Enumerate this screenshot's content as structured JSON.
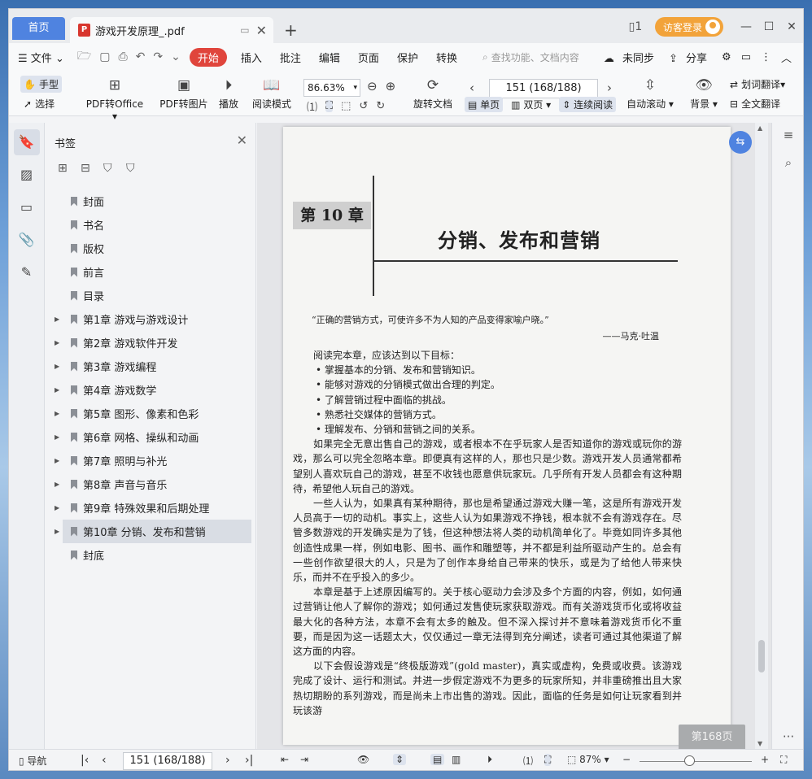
{
  "tabs": {
    "home": "首页",
    "doc_title": "游戏开发原理_.pdf",
    "add": "+"
  },
  "titlebar": {
    "login": "访客登录"
  },
  "menu": {
    "file": "文件",
    "start": "开始",
    "items": [
      "插入",
      "批注",
      "编辑",
      "页面",
      "保护",
      "转换"
    ],
    "search_placeholder": "查找功能、文档内容",
    "sync": "未同步",
    "share": "分享"
  },
  "ribbon": {
    "hand": "手型",
    "select": "选择",
    "pdf_to_office": "PDF转Office",
    "pdf_to_image": "PDF转图片",
    "play": "播放",
    "read_mode": "阅读模式",
    "zoom": "86.63%",
    "rotate": "旋转文档",
    "page_input": "151 (168/188)",
    "single": "单页",
    "double": "双页",
    "continuous": "连续阅读",
    "auto_scroll": "自动滚动",
    "background": "背景",
    "translate_word": "划词翻译",
    "translate_full": "全文翻译"
  },
  "bookmarks": {
    "title": "书签",
    "items": [
      {
        "label": "封面",
        "expandable": false
      },
      {
        "label": "书名",
        "expandable": false
      },
      {
        "label": "版权",
        "expandable": false
      },
      {
        "label": "前言",
        "expandable": false
      },
      {
        "label": "目录",
        "expandable": false
      },
      {
        "label": "第1章   游戏与游戏设计",
        "expandable": true
      },
      {
        "label": "第2章   游戏软件开发",
        "expandable": true
      },
      {
        "label": "第3章   游戏编程",
        "expandable": true
      },
      {
        "label": "第4章   游戏数学",
        "expandable": true
      },
      {
        "label": "第5章   图形、像素和色彩",
        "expandable": true
      },
      {
        "label": "第6章   网格、操纵和动画",
        "expandable": true
      },
      {
        "label": "第7章   照明与补光",
        "expandable": true
      },
      {
        "label": "第8章   声音与音乐",
        "expandable": true
      },
      {
        "label": "第9章   特殊效果和后期处理",
        "expandable": true
      },
      {
        "label": "第10章   分销、发布和营销",
        "expandable": true,
        "selected": true
      },
      {
        "label": "封底",
        "expandable": false
      }
    ]
  },
  "page": {
    "chapter_num": "第 10 章",
    "chapter_title": "分销、发布和营销",
    "quote": "“正确的营销方式，可使许多不为人知的产品变得家喻户晓。”",
    "quote_author": "——马克·吐温",
    "intro": "阅读完本章，应该达到以下目标：",
    "bullets": [
      "掌握基本的分销、发布和营销知识。",
      "能够对游戏的分销模式做出合理的判定。",
      "了解营销过程中面临的挑战。",
      "熟悉社交媒体的营销方式。",
      "理解发布、分销和营销之间的关系。"
    ],
    "paragraphs": [
      "如果完全无意出售自己的游戏，或者根本不在乎玩家人是否知道你的游戏或玩你的游戏，那么可以完全忽略本章。即便真有这样的人，那也只是少数。游戏开发人员通常都希望别人喜欢玩自己的游戏，甚至不收钱也愿意供玩家玩。几乎所有开发人员都会有这种期待，希望他人玩自己的游戏。",
      "一些人认为，如果真有某种期待，那也是希望通过游戏大赚一笔，这是所有游戏开发人员高于一切的动机。事实上，这些人认为如果游戏不挣钱，根本就不会有游戏存在。尽管多数游戏的开发确实是为了钱，但这种想法将人类的动机简单化了。毕竟如同许多其他创造性成果一样，例如电影、图书、画作和雕塑等，并不都是利益所驱动产生的。总会有一些创作欲望很大的人，只是为了创作本身给自己带来的快乐，或是为了给他人带来快乐，而并不在乎投入的多少。",
      "本章是基于上述原因编写的。关于核心驱动力会涉及多个方面的内容，例如，如何通过营销让他人了解你的游戏；如何通过发售使玩家获取游戏。而有关游戏货币化或将收益最大化的各种方法，本章不会有太多的触及。但不深入探讨并不意味着游戏货币化不重要，而是因为这一话题太大，仅仅通过一章无法得到充分阐述，读者可通过其他渠道了解这方面的内容。",
      "以下会假设游戏是“终极版游戏”(gold master)，真实或虚构，免费或收费。该游戏完成了设计、运行和测试。并进一步假定游戏不为更多的玩家所知，并非重磅推出且大家热切期盼的系列游戏，而是尚未上市出售的游戏。因此，面临的任务是如何让玩家看到并玩该游"
    ],
    "page_tag": "第168页"
  },
  "statusbar": {
    "nav": "导航",
    "page_input": "151 (168/188)",
    "zoom": "87%"
  }
}
